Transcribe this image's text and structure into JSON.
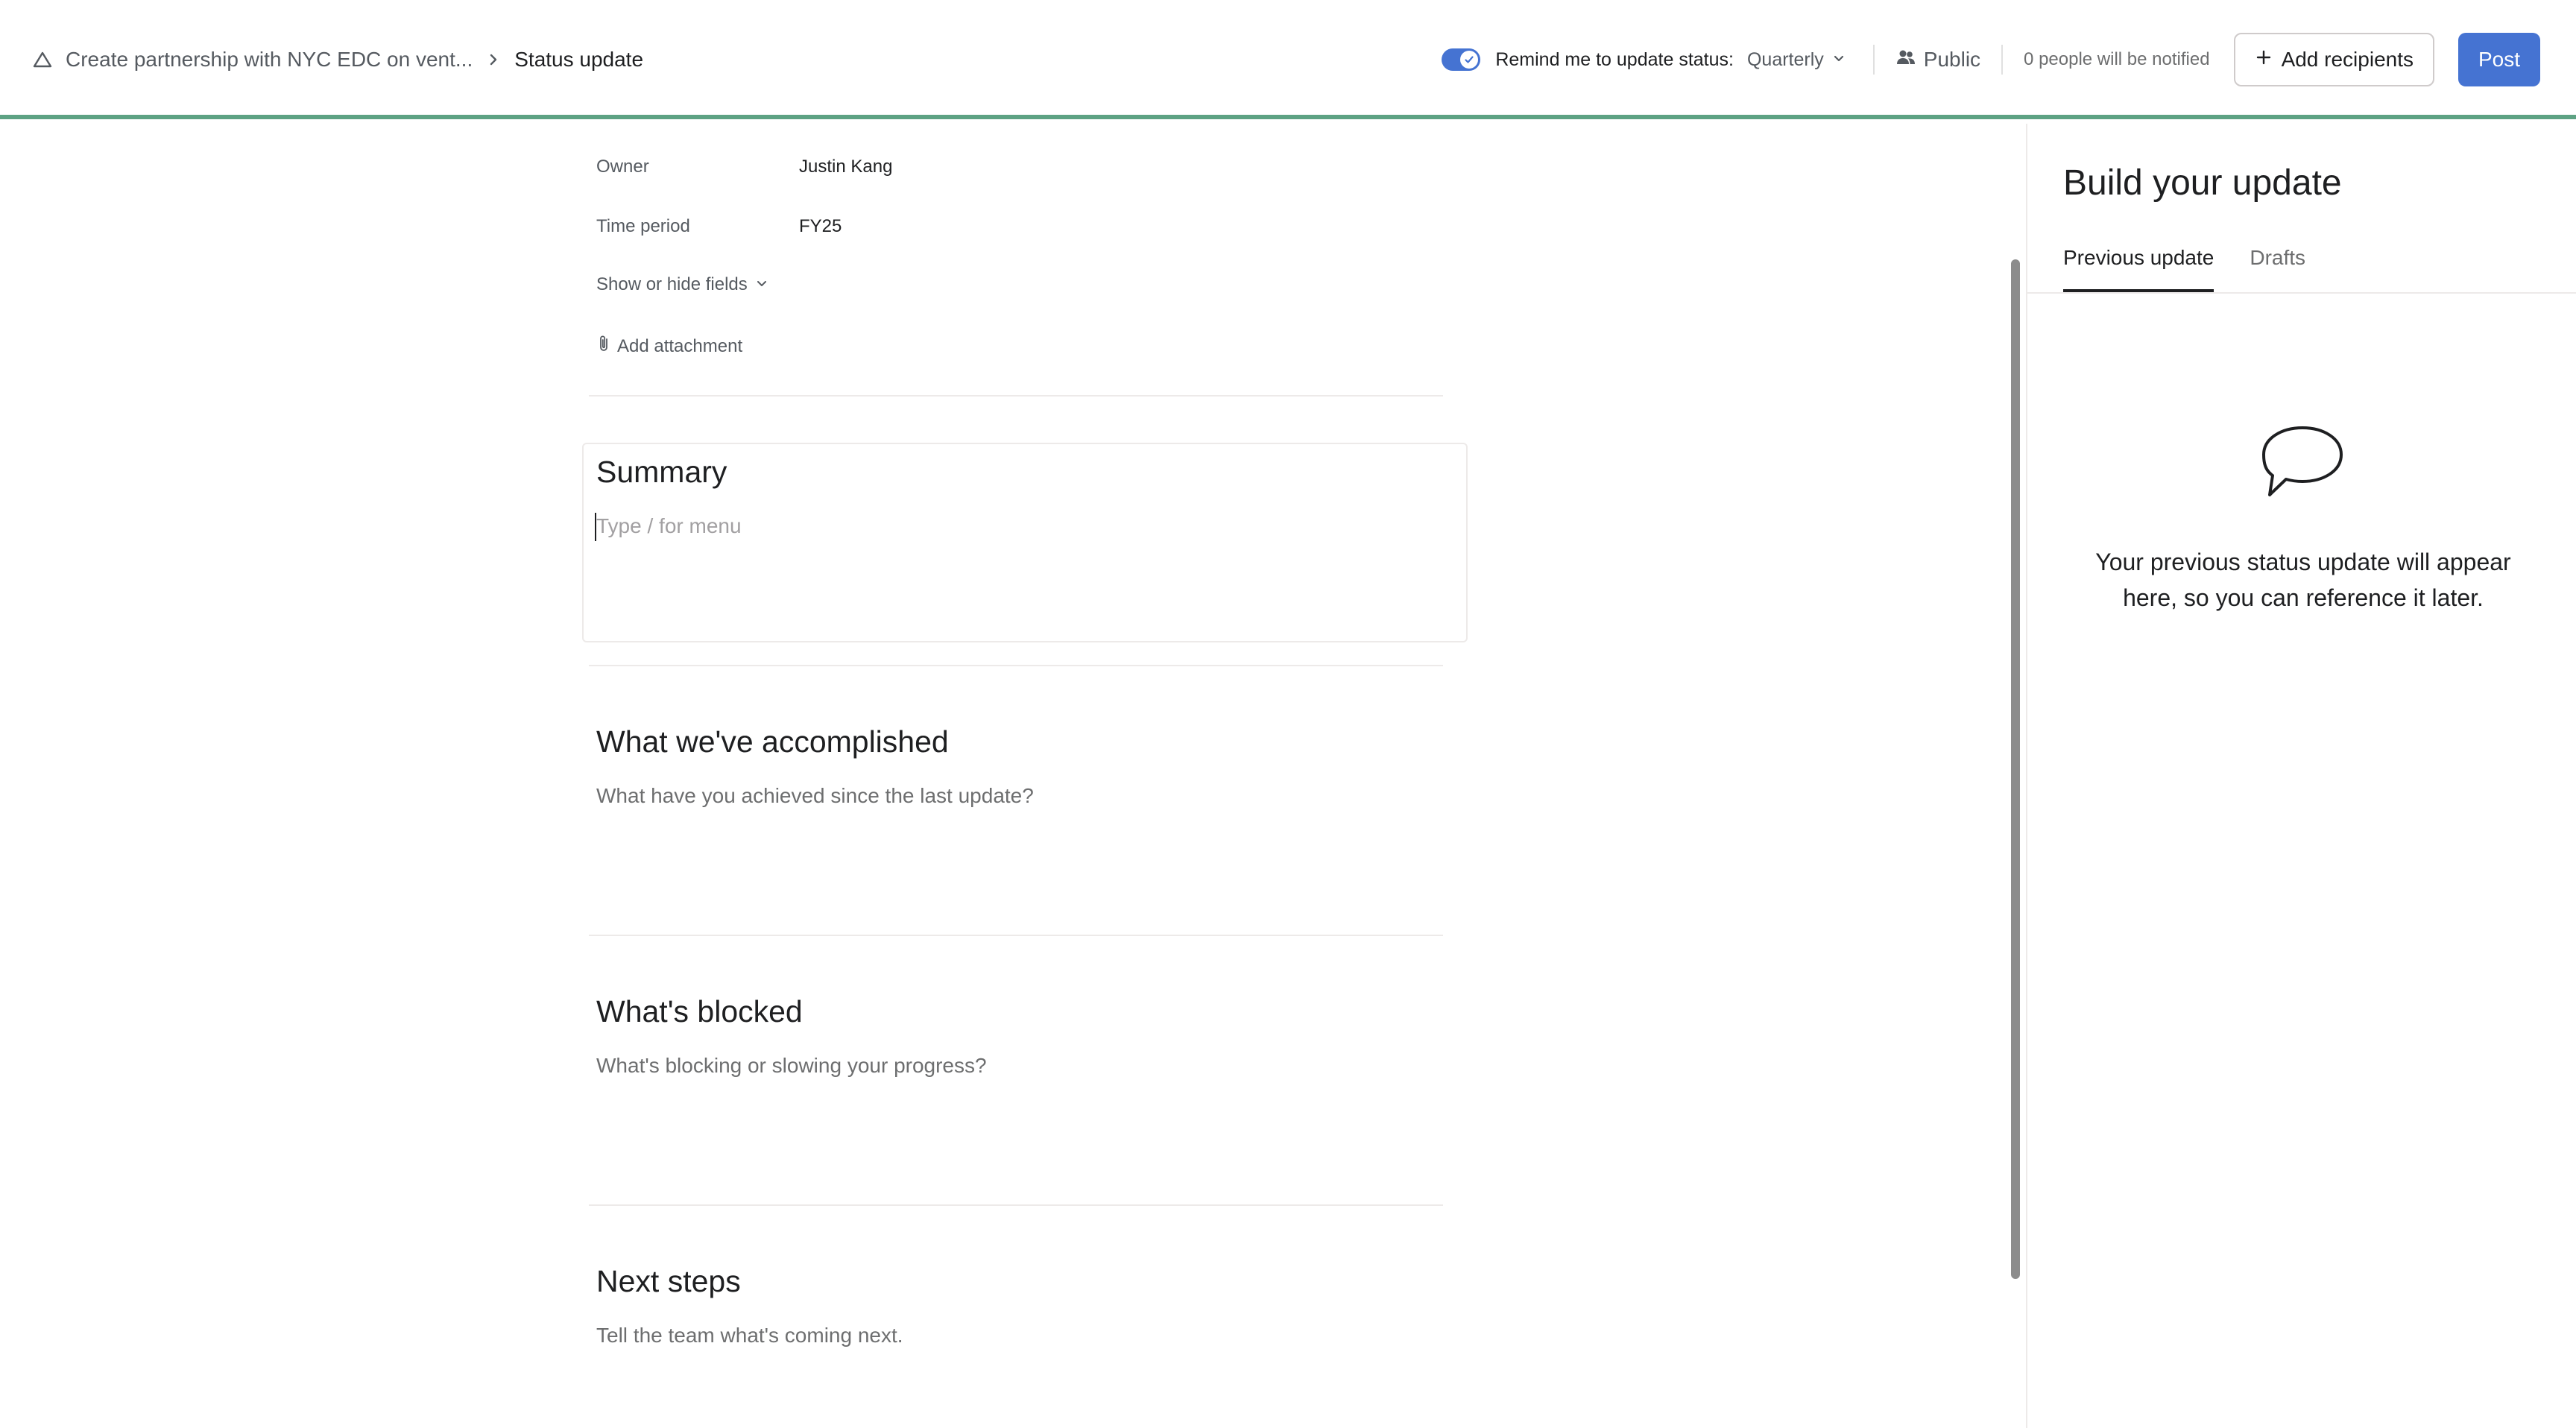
{
  "header": {
    "breadcrumb_parent": "Create partnership with NYC EDC on vent...",
    "breadcrumb_current": "Status update",
    "remind_label": "Remind me to update status:",
    "remind_cadence": "Quarterly",
    "remind_enabled": true,
    "visibility": "Public",
    "notified": "0 people will be notified",
    "add_recipients": "Add recipients",
    "post": "Post"
  },
  "fields": {
    "owner_label": "Owner",
    "owner_value": "Justin Kang",
    "period_label": "Time period",
    "period_value": "FY25",
    "show_hide": "Show or hide fields",
    "add_attachment": "Add attachment"
  },
  "sections": {
    "summary_title": "Summary",
    "summary_placeholder": "Type / for menu",
    "accomplished_title": "What we've accomplished",
    "accomplished_placeholder": "What have you achieved since the last update?",
    "blocked_title": "What's blocked",
    "blocked_placeholder": "What's blocking or slowing your progress?",
    "next_title": "Next steps",
    "next_placeholder": "Tell the team what's coming next."
  },
  "panel": {
    "title": "Build your update",
    "tabs": [
      "Previous update",
      "Drafts"
    ],
    "active_tab": "Previous update",
    "empty_message": "Your previous status update will appear here, so you can reference it later."
  },
  "colors": {
    "accent": "#4573d2",
    "header_border": "#5da283"
  },
  "icons": {
    "project": "triangle-outline-icon",
    "separator": "chevron-right-icon",
    "cadence": "chevron-down-icon",
    "visibility": "people-icon",
    "add": "plus-icon",
    "attachment": "paperclip-icon",
    "empty_state": "speech-bubble-icon"
  }
}
